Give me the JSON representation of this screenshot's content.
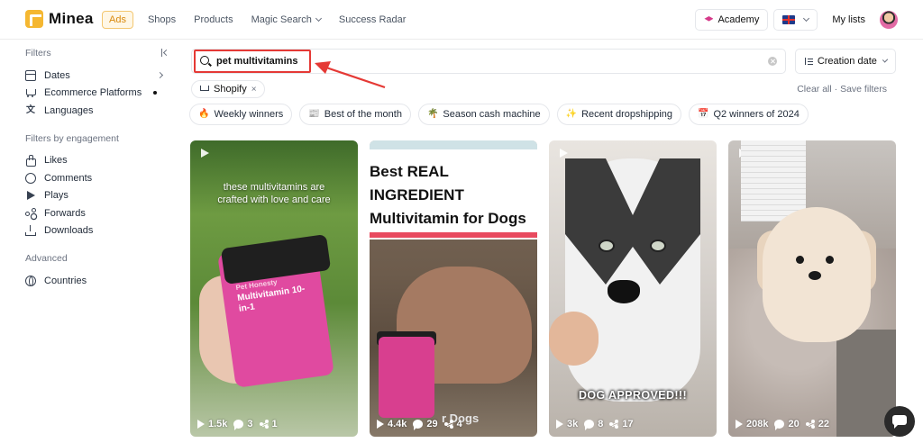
{
  "app": {
    "name": "Minea"
  },
  "nav": {
    "items": [
      {
        "label": "Ads",
        "active": true
      },
      {
        "label": "Shops"
      },
      {
        "label": "Products"
      },
      {
        "label": "Magic Search"
      },
      {
        "label": "Success Radar"
      }
    ]
  },
  "topright": {
    "academy": "Academy",
    "my_lists": "My lists"
  },
  "sidebar": {
    "filters_title": "Filters",
    "filters": [
      {
        "label": "Dates",
        "icon": "calendar-icon"
      },
      {
        "label": "Ecommerce Platforms",
        "icon": "cart-icon"
      },
      {
        "label": "Languages",
        "icon": "translate-icon"
      }
    ],
    "engagement_title": "Filters by engagement",
    "engagement": [
      {
        "label": "Likes",
        "icon": "thumbs-up-icon"
      },
      {
        "label": "Comments",
        "icon": "comment-icon"
      },
      {
        "label": "Plays",
        "icon": "play-icon"
      },
      {
        "label": "Forwards",
        "icon": "share-icon"
      },
      {
        "label": "Downloads",
        "icon": "download-icon"
      }
    ],
    "advanced_title": "Advanced",
    "advanced": [
      {
        "label": "Countries",
        "icon": "globe-icon"
      }
    ]
  },
  "search": {
    "value": "pet multivitamins"
  },
  "sort": {
    "label": "Creation date"
  },
  "active_filter": {
    "label": "Shopify"
  },
  "actions": {
    "clear_all": "Clear all",
    "separator": "·",
    "save_filters": "Save filters"
  },
  "quick_filters": [
    {
      "icon": "🔥",
      "label": "Weekly winners"
    },
    {
      "icon": "📰",
      "label": "Best of the month"
    },
    {
      "icon": "🌴",
      "label": "Season cash machine"
    },
    {
      "icon": "✨",
      "label": "Recent dropshipping"
    },
    {
      "icon": "📅",
      "label": "Q2 winners of 2024"
    }
  ],
  "cards": [
    {
      "overlay": "these multivitamins are crafted with love and care",
      "product_brand": "Pet Honesty",
      "product_name": "Multivitamin 10-in-1",
      "plays": "1.5k",
      "comments": "3",
      "shares": "1"
    },
    {
      "title_lines": [
        "Best REAL",
        "INGREDIENT",
        "Multivitamin for Dogs"
      ],
      "bottom_text": "r Dogs",
      "plays": "4.4k",
      "comments": "29",
      "shares": "4"
    },
    {
      "overlay": "DOG APPROVED!!!",
      "plays": "3k",
      "comments": "8",
      "shares": "17"
    },
    {
      "plays": "208k",
      "comments": "20",
      "shares": "22"
    }
  ],
  "colors": {
    "accent": "#f5b731",
    "highlight_red": "#e53935"
  }
}
